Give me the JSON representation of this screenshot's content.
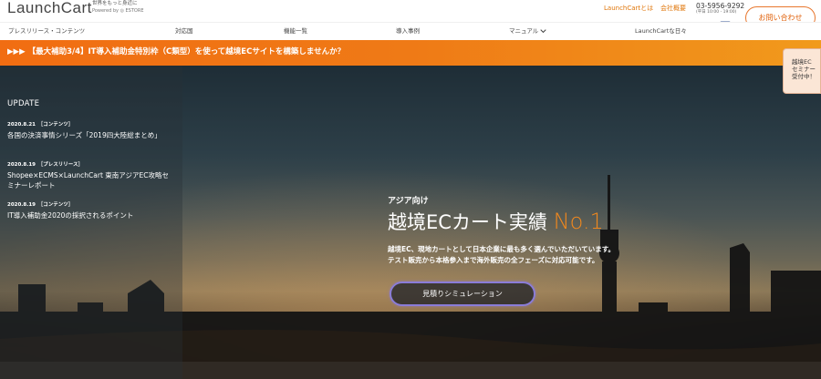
{
  "header": {
    "logo": "LaunchCart",
    "tagline": "世界をもっと身近に",
    "powered": "Powered by ◎ ESTORE",
    "links": [
      "LaunchCartとは",
      "会社概要"
    ],
    "phone": "03-5956-9292",
    "hours": "(平日 10:00 - 19:00)",
    "contact_label": "お問い合わせ"
  },
  "nav": {
    "items": [
      "プレスリリース・コンテンツ",
      "対応国",
      "機能一覧",
      "導入事例",
      "マニュアル",
      "LaunchCartな日々"
    ]
  },
  "banner": {
    "text": "▶▶▶ 【最大補助3/4】IT導入補助金特別枠（C類型）を使って越境ECサイトを構築しませんか？"
  },
  "side_tab": {
    "label": "越境EC セミナー 受付中！"
  },
  "update": {
    "title": "UPDATE",
    "items": [
      {
        "date": "2020.8.21　［コンテンツ］",
        "title": "各国の決済事情シリーズ「2019四大陸総まとめ」"
      },
      {
        "date": "2020.8.19　［プレスリリース］",
        "title": "Shopee×ECMS×LaunchCart 東南アジアEC攻略セミナーレポート"
      },
      {
        "date": "2020.8.19　［コンテンツ］",
        "title": "IT導入補助金2020の採択されるポイント"
      }
    ]
  },
  "hero": {
    "subtitle": "アジア向け",
    "title": "越境ECカート実績",
    "title_accent": "No.1",
    "desc_line1": "越境EC、現地カートとして日本企業に最も多く選んでいただいています。",
    "desc_line2": "テスト販売から本格参入まで海外販売の全フェーズに対応可能です。",
    "button_label": "見積りシミュレーション"
  },
  "colors": {
    "accent": "#f0881e",
    "banner": "#f16d12",
    "twitter": "#1da1f2",
    "facebook": "#3b5998",
    "button_border": "#8a7cd8"
  },
  "icons": [
    "twitter-icon",
    "facebook-icon",
    "chevron-down-icon"
  ]
}
